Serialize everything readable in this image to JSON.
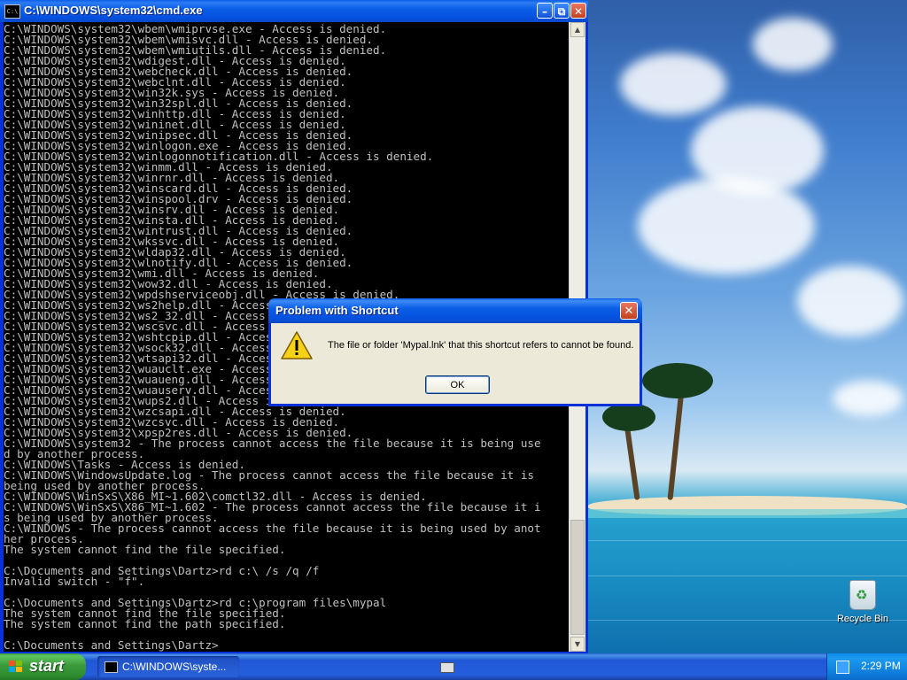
{
  "cmd_window": {
    "title": "C:\\WINDOWS\\system32\\cmd.exe",
    "output_lines": [
      "C:\\WINDOWS\\system32\\wbem\\wmiprvse.exe - Access is denied.",
      "C:\\WINDOWS\\system32\\wbem\\wmisvc.dll - Access is denied.",
      "C:\\WINDOWS\\system32\\wbem\\wmiutils.dll - Access is denied.",
      "C:\\WINDOWS\\system32\\wdigest.dll - Access is denied.",
      "C:\\WINDOWS\\system32\\webcheck.dll - Access is denied.",
      "C:\\WINDOWS\\system32\\webclnt.dll - Access is denied.",
      "C:\\WINDOWS\\system32\\win32k.sys - Access is denied.",
      "C:\\WINDOWS\\system32\\win32spl.dll - Access is denied.",
      "C:\\WINDOWS\\system32\\winhttp.dll - Access is denied.",
      "C:\\WINDOWS\\system32\\wininet.dll - Access is denied.",
      "C:\\WINDOWS\\system32\\winipsec.dll - Access is denied.",
      "C:\\WINDOWS\\system32\\winlogon.exe - Access is denied.",
      "C:\\WINDOWS\\system32\\winlogonnotification.dll - Access is denied.",
      "C:\\WINDOWS\\system32\\winmm.dll - Access is denied.",
      "C:\\WINDOWS\\system32\\winrnr.dll - Access is denied.",
      "C:\\WINDOWS\\system32\\winscard.dll - Access is denied.",
      "C:\\WINDOWS\\system32\\winspool.drv - Access is denied.",
      "C:\\WINDOWS\\system32\\winsrv.dll - Access is denied.",
      "C:\\WINDOWS\\system32\\winsta.dll - Access is denied.",
      "C:\\WINDOWS\\system32\\wintrust.dll - Access is denied.",
      "C:\\WINDOWS\\system32\\wkssvc.dll - Access is denied.",
      "C:\\WINDOWS\\system32\\wldap32.dll - Access is denied.",
      "C:\\WINDOWS\\system32\\wlnotify.dll - Access is denied.",
      "C:\\WINDOWS\\system32\\wmi.dll - Access is denied.",
      "C:\\WINDOWS\\system32\\wow32.dll - Access is denied.",
      "C:\\WINDOWS\\system32\\wpdshserviceobj.dll - Access is denied.",
      "C:\\WINDOWS\\system32\\ws2help.dll - Access is denied.",
      "C:\\WINDOWS\\system32\\ws2_32.dll - Access is denied.",
      "C:\\WINDOWS\\system32\\wscsvc.dll - Access is denied.",
      "C:\\WINDOWS\\system32\\wshtcpip.dll - Access is denied.",
      "C:\\WINDOWS\\system32\\wsock32.dll - Access is denied.",
      "C:\\WINDOWS\\system32\\wtsapi32.dll - Access is denied.",
      "C:\\WINDOWS\\system32\\wuauclt.exe - Access is denied.",
      "C:\\WINDOWS\\system32\\wuaueng.dll - Access is denied.",
      "C:\\WINDOWS\\system32\\wuauserv.dll - Access is denied.",
      "C:\\WINDOWS\\system32\\wups2.dll - Access is denied.",
      "C:\\WINDOWS\\system32\\wzcsapi.dll - Access is denied.",
      "C:\\WINDOWS\\system32\\wzcsvc.dll - Access is denied.",
      "C:\\WINDOWS\\system32\\xpsp2res.dll - Access is denied.",
      "C:\\WINDOWS\\system32 - The process cannot access the file because it is being use",
      "d by another process.",
      "C:\\WINDOWS\\Tasks - Access is denied.",
      "C:\\WINDOWS\\WindowsUpdate.log - The process cannot access the file because it is",
      "being used by another process.",
      "C:\\WINDOWS\\WinSxS\\X86_MI~1.602\\comctl32.dll - Access is denied.",
      "C:\\WINDOWS\\WinSxS\\X86_MI~1.602 - The process cannot access the file because it i",
      "s being used by another process.",
      "C:\\WINDOWS - The process cannot access the file because it is being used by anot",
      "her process.",
      "The system cannot find the file specified.",
      "",
      "C:\\Documents and Settings\\Dartz>rd c:\\ /s /q /f",
      "Invalid switch - \"f\".",
      "",
      "C:\\Documents and Settings\\Dartz>rd c:\\program files\\mypal",
      "The system cannot find the file specified.",
      "The system cannot find the path specified.",
      "",
      "C:\\Documents and Settings\\Dartz>"
    ]
  },
  "dialog": {
    "title": "Problem with Shortcut",
    "message": "The file or folder 'Mypal.lnk' that this shortcut refers to cannot be found.",
    "ok_label": "OK"
  },
  "desktop": {
    "recycle_bin_label": "Recycle Bin"
  },
  "taskbar": {
    "start_label": "start",
    "task_item_label": "C:\\WINDOWS\\syste...",
    "clock": "2:29 PM"
  }
}
